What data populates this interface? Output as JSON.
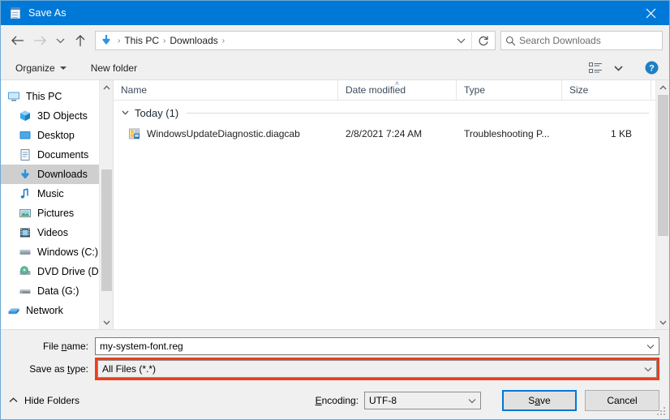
{
  "window": {
    "title": "Save As",
    "title_icon": "notepad-icon",
    "close_label": "✕",
    "titlebar_color": "#0078d7"
  },
  "nav": {
    "back_icon": "arrow-left-icon",
    "forward_icon": "arrow-right-icon",
    "recent_icon": "chevron-down-icon",
    "up_icon": "arrow-up-icon",
    "address_icon": "downloads-arrow-icon",
    "breadcrumbs": [
      "This PC",
      "Downloads"
    ],
    "separator": "›",
    "dropdown_icon": "chevron-down-icon",
    "refresh_icon": "refresh-icon",
    "search": {
      "icon": "search-icon",
      "placeholder": "Search Downloads",
      "value": ""
    }
  },
  "toolbar": {
    "organize_label": "Organize",
    "new_folder_label": "New folder",
    "view_icon": "view-list-icon",
    "view_caret_icon": "chevron-down-icon",
    "help_icon": "help-circle-icon"
  },
  "sidebar": {
    "items": [
      {
        "label": "This PC",
        "icon": "monitor-icon",
        "level": 0,
        "selected": false
      },
      {
        "label": "3D Objects",
        "icon": "cube-icon",
        "level": 1,
        "selected": false
      },
      {
        "label": "Desktop",
        "icon": "desktop-icon",
        "level": 1,
        "selected": false
      },
      {
        "label": "Documents",
        "icon": "documents-icon",
        "level": 1,
        "selected": false
      },
      {
        "label": "Downloads",
        "icon": "downloads-icon",
        "level": 1,
        "selected": true
      },
      {
        "label": "Music",
        "icon": "music-note-icon",
        "level": 1,
        "selected": false
      },
      {
        "label": "Pictures",
        "icon": "picture-icon",
        "level": 1,
        "selected": false
      },
      {
        "label": "Videos",
        "icon": "video-icon",
        "level": 1,
        "selected": false
      },
      {
        "label": "Windows (C:)",
        "icon": "hard-drive-icon",
        "level": 1,
        "selected": false
      },
      {
        "label": "DVD Drive (D:) C",
        "icon": "dvd-drive-icon",
        "level": 1,
        "selected": false
      },
      {
        "label": "Data (G:)",
        "icon": "hard-drive-icon",
        "level": 1,
        "selected": false
      },
      {
        "label": "Network",
        "icon": "network-icon",
        "level": 0,
        "selected": false
      }
    ],
    "scrollbar": {
      "up_icon": "chevron-up-icon",
      "down_icon": "chevron-down-icon"
    }
  },
  "filelist": {
    "columns": [
      {
        "key": "name",
        "label": "Name",
        "sorted": false
      },
      {
        "key": "date",
        "label": "Date modified",
        "sorted": true
      },
      {
        "key": "type",
        "label": "Type",
        "sorted": false
      },
      {
        "key": "size",
        "label": "Size",
        "sorted": false
      }
    ],
    "sort_indicator": "˄",
    "groups": [
      {
        "label": "Today (1)",
        "chevron_icon": "chevron-down-icon",
        "rows": [
          {
            "icon": "diagcab-file-icon",
            "name": "WindowsUpdateDiagnostic.diagcab",
            "date": "2/8/2021 7:24 AM",
            "type": "Troubleshooting P...",
            "size": "1 KB"
          }
        ]
      }
    ],
    "scrollbar": {
      "up_icon": "chevron-up-icon",
      "down_icon": "chevron-down-icon"
    }
  },
  "form": {
    "filename": {
      "label_pre": "File ",
      "label_accel": "n",
      "label_post": "ame:",
      "value": "my-system-font.reg",
      "arrow_icon": "chevron-down-icon"
    },
    "savetype": {
      "label_pre": "Save as ",
      "label_accel": "t",
      "label_post": "ype:",
      "value": "All Files  (*.*)",
      "arrow_icon": "chevron-down-icon",
      "highlight_color": "#e8401c",
      "highlighted": true
    }
  },
  "footer": {
    "hide_folders_label": "Hide Folders",
    "hide_folders_icon": "chevron-up-icon",
    "encoding": {
      "label_accel": "E",
      "label_post": "ncoding:",
      "value": "UTF-8",
      "arrow_icon": "chevron-down-icon"
    },
    "save_button": {
      "pre": "S",
      "accel": "a",
      "post": "ve",
      "focused": true
    },
    "cancel_button": {
      "label": "Cancel"
    }
  }
}
